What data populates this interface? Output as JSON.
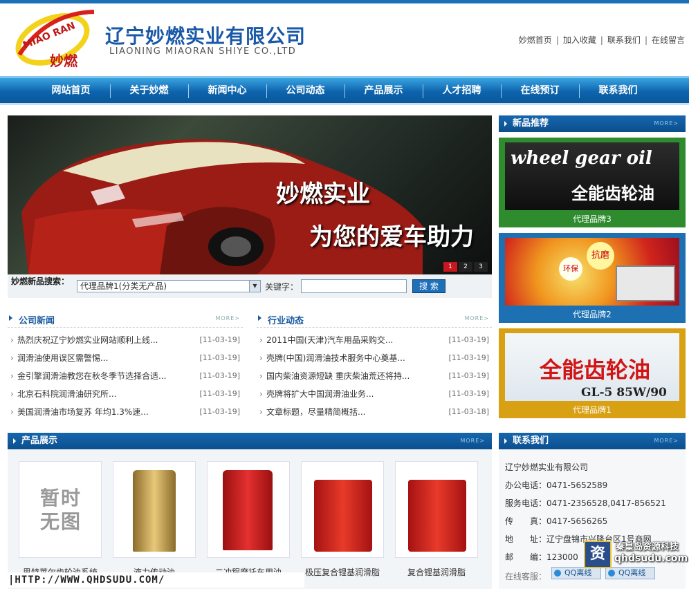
{
  "header": {
    "logo_text_en": "MIAO RAN",
    "logo_text_cn": "妙燃",
    "company_cn": "辽宁妙燃实业有限公司",
    "company_en": "LIAONING MIAORAN SHIYE CO.,LTD",
    "links": [
      "妙燃首页",
      "加入收藏",
      "联系我们",
      "在线留言"
    ]
  },
  "nav": [
    "网站首页",
    "关于妙燃",
    "新闻中心",
    "公司动态",
    "产品展示",
    "人才招聘",
    "在线预订",
    "联系我们"
  ],
  "banner": {
    "line1": "妙燃实业",
    "line2": "为您的爱车助力",
    "pages": [
      "1",
      "2",
      "3"
    ]
  },
  "search": {
    "label": "妙燃新品搜索：",
    "selected": "代理品牌1(分类无产品)",
    "keyword_label": "关键字：",
    "keyword_value": "",
    "button": "搜 索"
  },
  "more_label": "MORE>",
  "company_news": {
    "title": "公司新闻",
    "items": [
      {
        "text": "热烈庆祝辽宁妙燃实业网站顺利上线...",
        "date": "[11-03-19]"
      },
      {
        "text": "润滑油使用误区需警惕...",
        "date": "[11-03-19]"
      },
      {
        "text": "金引擎润滑油教您在秋冬季节选择合适...",
        "date": "[11-03-19]"
      },
      {
        "text": "北京石科院润滑油研究所...",
        "date": "[11-03-19]"
      },
      {
        "text": "美国润滑油市场复苏 年均1.3%速...",
        "date": "[11-03-19]"
      }
    ]
  },
  "industry_news": {
    "title": "行业动态",
    "items": [
      {
        "text": "2011中国(天津)汽车用品采购交...",
        "date": "[11-03-19]"
      },
      {
        "text": "壳牌(中国)润滑油技术服务中心奠基...",
        "date": "[11-03-19]"
      },
      {
        "text": "国内柴油资源短缺 重庆柴油荒还将持...",
        "date": "[11-03-19]"
      },
      {
        "text": "壳牌将扩大中国润滑油业务...",
        "date": "[11-03-19]"
      },
      {
        "text": "文章标题，尽量精简概括...",
        "date": "[11-03-18]"
      }
    ]
  },
  "new_products": {
    "title": "新品推荐",
    "items": [
      {
        "caption": "代理品牌3",
        "img_text1": "wheel gear oil",
        "img_text2": "全能齿轮油",
        "color": "#2e8b2e"
      },
      {
        "caption": "代理品牌2",
        "img_text1": "环保",
        "img_text2": "抗磨",
        "color": "#1d70b2"
      },
      {
        "caption": "代理品牌1",
        "img_text1": "全能齿轮油",
        "img_text2": "GL-5 85W/90",
        "color": "#d8a013"
      }
    ]
  },
  "products": {
    "title": "产品展示",
    "placeholder_text": "暂时无图",
    "items": [
      "思特莱尔齿轮油系统",
      "液力传动油",
      "二冲程摩托车用油",
      "极压复合锂基润滑脂",
      "复合锂基润滑脂"
    ]
  },
  "contact": {
    "title": "联系我们",
    "company": "辽宁妙燃实业有限公司",
    "lines": [
      "办公电话：0471-5652589",
      "服务电话：0471-2356528,0417-856521",
      "传　　真：0417-5656265",
      "地　　址：辽宁盘锦市兴隆台区1号商网",
      "邮　　编：123000"
    ],
    "service_label": "在线客服：",
    "qq_labels": [
      "QQ离线",
      "QQ离线"
    ]
  },
  "footer_url": "|HTTP://WWW.QHDSUDU.COM/",
  "watermark": {
    "line1": "秦皇岛资源科技",
    "line2": "qhdsudu.com"
  }
}
